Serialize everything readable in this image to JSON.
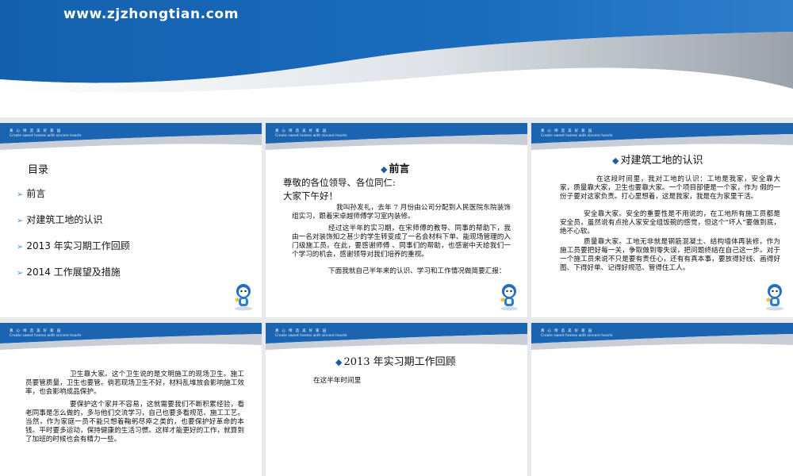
{
  "banner": {
    "url": "www.zjzhongtian.com"
  },
  "slide_header": {
    "cn": "真 心 缔 造 美 好 家 园",
    "en": "Create sweet homes with sincere hearts"
  },
  "slide1": {
    "title": "目录",
    "items": [
      "前言",
      "对建筑工地的认识",
      "2013 年实习期工作回顾",
      "2014 工作展望及措施"
    ]
  },
  "slide2": {
    "heading": "前言",
    "greet1": "尊敬的各位领导、各位同仁:",
    "greet2": "大家下午好！",
    "p1": "我叫孙发礼，去年 7 月份由公司分配到人民医院东院装饰组实习，跟着宋卓越师傅学习室内装修。",
    "p2": "经过这半年的实习期，在宋师傅的教导、同事的帮助下，我由一名对装饰知之甚少的学生转变成了一名会材料下单、能现场管理的入门级施工员。在此，要感谢师傅 、同事们的帮助，也感谢中天给我们一个学习的机会，感谢领导对我们培养的重视。",
    "p3": "下面我就自己半年来的认识、学习和工作情况做简要汇报："
  },
  "slide3": {
    "heading": "对建筑工地的认识",
    "p1": "在这段时间里，我对工地的认识：工地是我家，安全靠大家，质量靠大家，卫生也要靠大家。一个项目部便是一个家，作为 假的一份子要对这家负责。打心里想着，这是我家，我是在为家里干活。",
    "p2": "安全靠大家。安全的重要性是不用说的，在工地所有施工员都是安全员，虽然说有点抢人家安全组饭碗的感觉，但这个“坏人”要做到底，绝不心软。",
    "p3": "质量靠大家。工地无非就是钢筋混凝土、结构墙体再装修，作为施工员要把好每一关，争取做到零失误，把问题终结在自己这一步。对于一个施工员来说不只是要有责任心，还有有真本事，要放得好线、画得好图、下得好单、记得好规范、管得住工人。"
  },
  "slide4": {
    "p1": "卫生靠大家。这个卫生说的是文明施工的现场卫生。施工员要管质量，卫生也要管。倘若现场卫生不好，材料乱堆放会影响施工效率，也会影响成品保护。",
    "p2": "要保护这个家并不容易，这就需要我们不断积累经验，看老同事是怎么做的，多与他们交流学习，自己也要多看规范、施工工艺。当然，作为家庭一员不能只想着鞠躬尽瘁之类的，也要保护好革命的本钱。平时要多运动，保持健康的生活习惯。这样才能更好的工作，就算到了加班的时候也会有精力一些。"
  },
  "slide5": {
    "heading": "2013 年实习期工作回顾",
    "p1": "在这半年时间里"
  },
  "colors": {
    "brand_blue": "#1f5d9c",
    "light_blue": "#4d8fd1"
  }
}
